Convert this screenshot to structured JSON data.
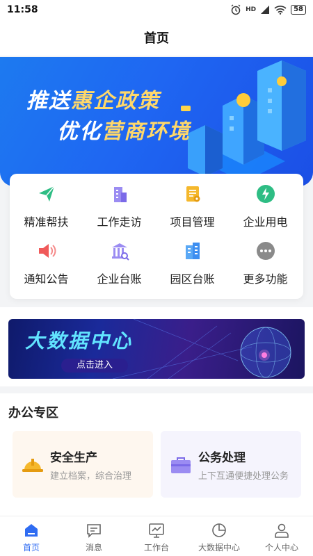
{
  "status_bar": {
    "time": "11:58",
    "network": "HD",
    "battery": "58"
  },
  "header": {
    "title": "首页"
  },
  "hero": {
    "line1_pre": "推送",
    "line1_hl": "惠企政策",
    "line2_pre": "优化",
    "line2_hl": "营商环境"
  },
  "menu": [
    {
      "label": "精准帮扶",
      "icon": "paper-plane-icon"
    },
    {
      "label": "工作走访",
      "icon": "building-icon"
    },
    {
      "label": "项目管理",
      "icon": "document-gear-icon"
    },
    {
      "label": "企业用电",
      "icon": "lightning-icon"
    },
    {
      "label": "通知公告",
      "icon": "speaker-icon"
    },
    {
      "label": "企业台账",
      "icon": "bank-search-icon"
    },
    {
      "label": "园区台账",
      "icon": "buildings-icon"
    },
    {
      "label": "更多功能",
      "icon": "more-dots-icon"
    }
  ],
  "bigdata": {
    "title": "大数据中心",
    "button": "点击进入"
  },
  "office": {
    "title": "办公专区",
    "cards": [
      {
        "title": "安全生产",
        "subtitle": "建立档案，综合治理",
        "icon": "helmet-icon"
      },
      {
        "title": "公务处理",
        "subtitle": "上下互通便捷处理公务",
        "icon": "briefcase-icon"
      }
    ]
  },
  "tabs": [
    {
      "label": "首页",
      "icon": "home-icon",
      "active": true
    },
    {
      "label": "消息",
      "icon": "message-icon",
      "active": false
    },
    {
      "label": "工作台",
      "icon": "workbench-icon",
      "active": false
    },
    {
      "label": "大数据中心",
      "icon": "pie-chart-icon",
      "active": false
    },
    {
      "label": "个人中心",
      "icon": "user-icon",
      "active": false
    }
  ],
  "colors": {
    "accent": "#2f6cf2",
    "hero_highlight": "#ffd86a",
    "bigdata_title": "#62e4ff"
  }
}
